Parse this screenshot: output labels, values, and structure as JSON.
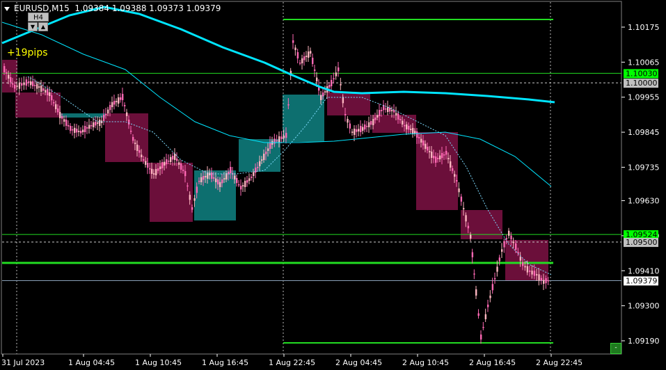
{
  "header": {
    "symbol": "EURUSD,M15",
    "ohlc": "1.09384 1.09388 1.09373 1.09379"
  },
  "timeframe": {
    "label": "H4",
    "up_icon": "up-triangle-icon",
    "down_icon": "down-triangle-icon"
  },
  "annotation": {
    "pips": "+19pips"
  },
  "price_axis": {
    "min": 1.0915,
    "max": 1.1021,
    "ticks": [
      "1.10175",
      "1.10065",
      "1.09955",
      "1.09845",
      "1.09735",
      "1.09630",
      "1.09520",
      "1.09410",
      "1.09300",
      "1.09190"
    ],
    "tags": [
      {
        "value": "1.10030",
        "price": 1.1003,
        "color": "#00ff00"
      },
      {
        "value": "1.10000",
        "price": 1.1,
        "color": "#c0c0c0"
      },
      {
        "value": "1.09524",
        "price": 1.09524,
        "color": "#00ff00"
      },
      {
        "value": "1.09500",
        "price": 1.095,
        "color": "#c0c0c0"
      },
      {
        "value": "1.09379",
        "price": 1.09379,
        "color": "#ffffff"
      }
    ]
  },
  "time_axis": {
    "labels": [
      "31 Jul 2023",
      "1 Aug 04:45",
      "1 Aug 10:45",
      "1 Aug 16:45",
      "1 Aug 22:45",
      "2 Aug 04:45",
      "2 Aug 10:45",
      "2 Aug 16:45",
      "2 Aug 22:45"
    ]
  },
  "colors": {
    "background": "#000000",
    "grid": "#808080",
    "bull_candle": "#ffb6c1",
    "bear_candle": "#ff69b4",
    "h4_bear": "#6b0f3a",
    "h4_bull": "#0d6f6f",
    "ma_fast": "#00e5ff",
    "level_line": "#22dd22"
  },
  "corner_button": {
    "label": "-"
  }
}
